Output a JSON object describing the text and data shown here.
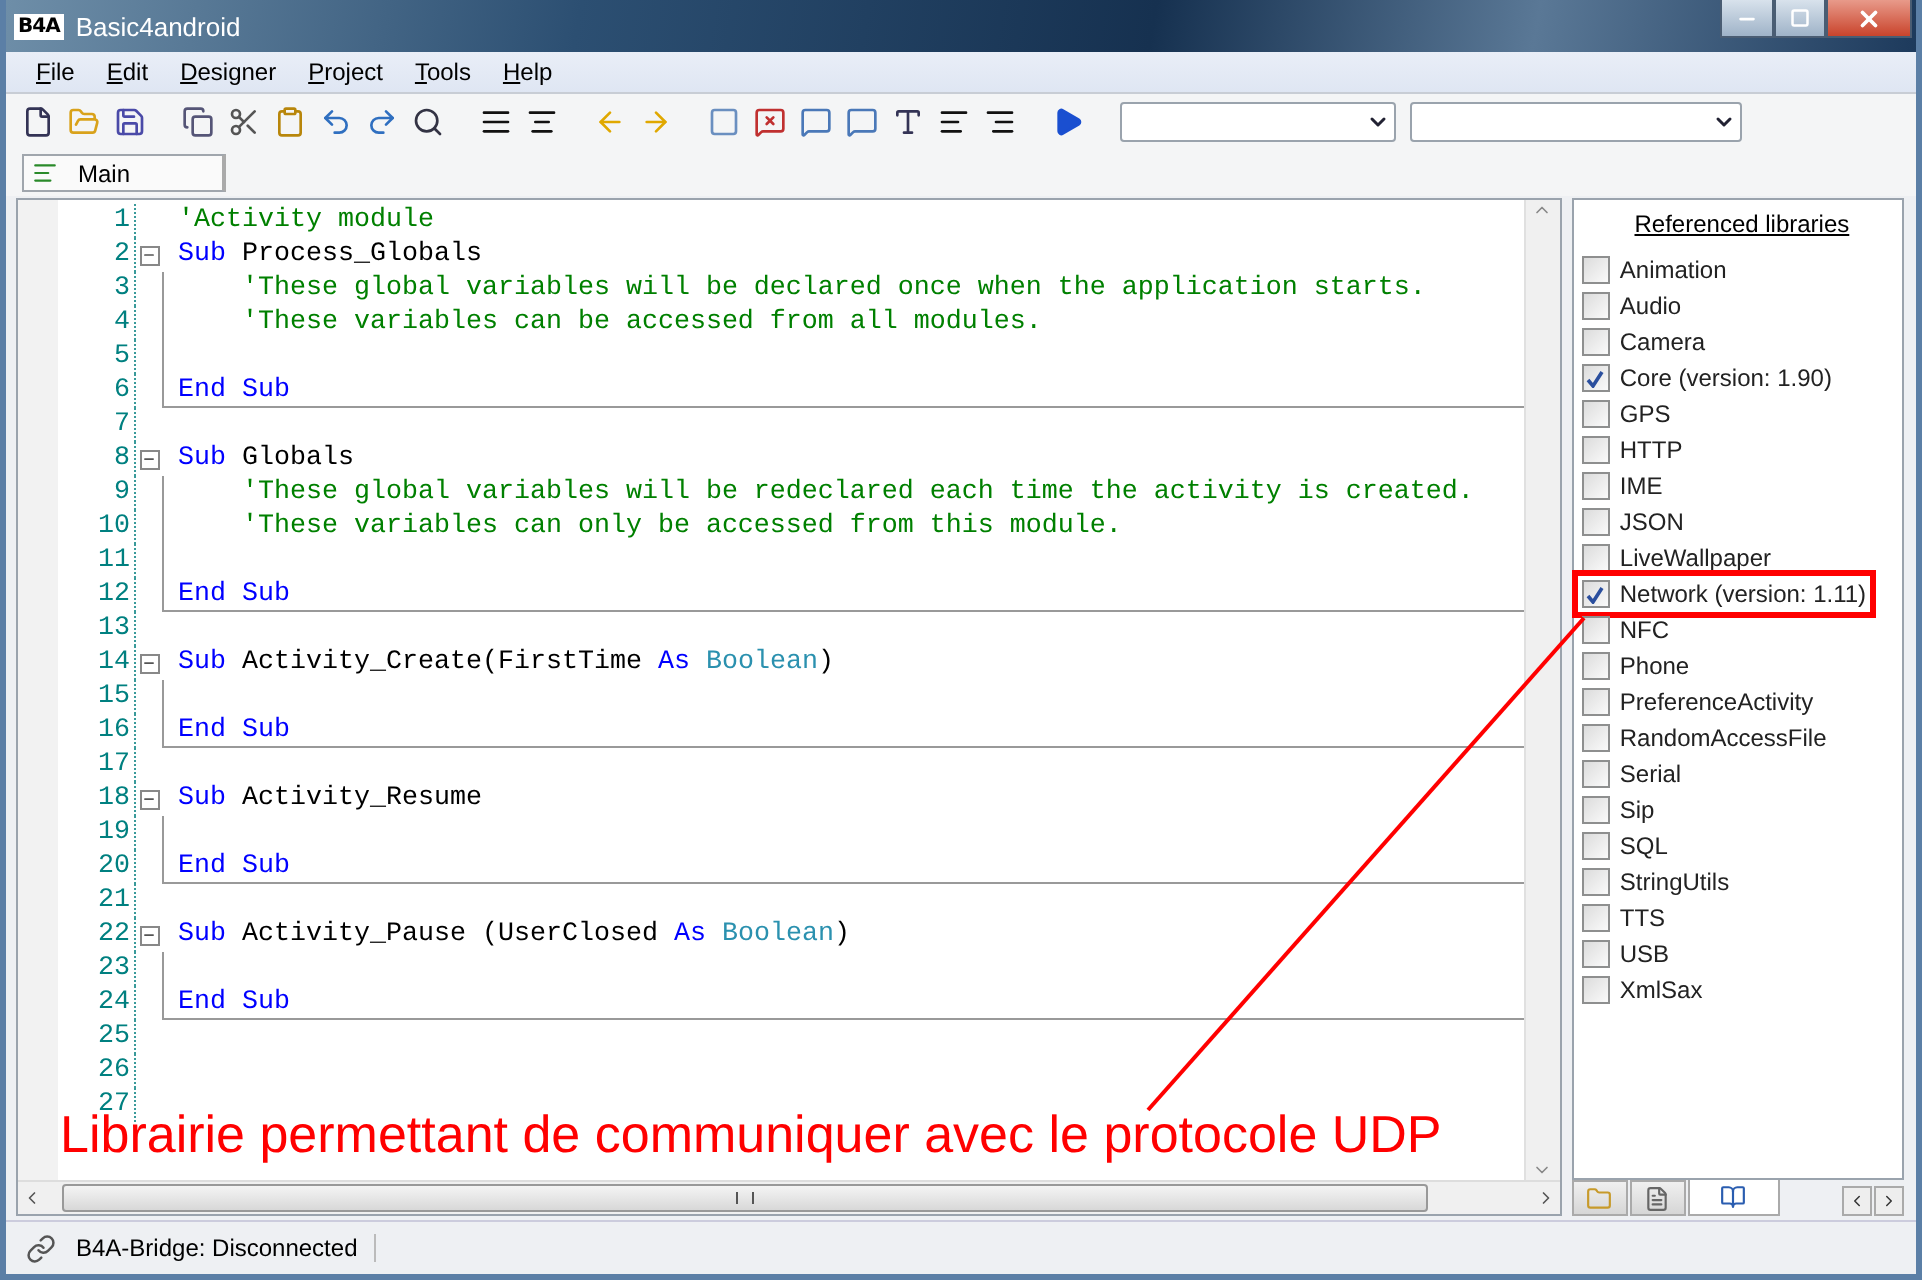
{
  "window": {
    "logo": "B4A",
    "title": "Basic4android"
  },
  "menu": [
    "File",
    "Edit",
    "Designer",
    "Project",
    "Tools",
    "Help"
  ],
  "tabs": [
    {
      "label": "Main",
      "selected": true
    }
  ],
  "editor": {
    "lines": [
      {
        "number": "1",
        "fold": false,
        "block_end": false,
        "tokens": [
          {
            "kind": "comment",
            "text": "'Activity module"
          }
        ]
      },
      {
        "number": "2",
        "fold": true,
        "block_end": false,
        "tokens": [
          {
            "kind": "keyword",
            "text": "Sub"
          },
          {
            "kind": "plain",
            "text": " Process_Globals"
          }
        ]
      },
      {
        "number": "3",
        "fold": false,
        "block_end": false,
        "tokens": [
          {
            "kind": "comment",
            "text": "    'These global variables will be declared once when the application starts."
          }
        ]
      },
      {
        "number": "4",
        "fold": false,
        "block_end": false,
        "tokens": [
          {
            "kind": "comment",
            "text": "    'These variables can be accessed from all modules."
          }
        ]
      },
      {
        "number": "5",
        "fold": false,
        "block_end": false
      },
      {
        "number": "6",
        "fold": false,
        "block_end": true,
        "tokens": [
          {
            "kind": "keyword",
            "text": "End Sub"
          }
        ]
      },
      {
        "number": "7",
        "fold": false,
        "block_end": false
      },
      {
        "number": "8",
        "fold": true,
        "block_end": false,
        "tokens": [
          {
            "kind": "keyword",
            "text": "Sub"
          },
          {
            "kind": "plain",
            "text": " Globals"
          }
        ]
      },
      {
        "number": "9",
        "fold": false,
        "block_end": false,
        "tokens": [
          {
            "kind": "comment",
            "text": "    'These global variables will be redeclared each time the activity is created."
          }
        ]
      },
      {
        "number": "10",
        "fold": false,
        "block_end": false,
        "tokens": [
          {
            "kind": "comment",
            "text": "    'These variables can only be accessed from this module."
          }
        ]
      },
      {
        "number": "11",
        "fold": false,
        "block_end": false
      },
      {
        "number": "12",
        "fold": false,
        "block_end": true,
        "tokens": [
          {
            "kind": "keyword",
            "text": "End Sub"
          }
        ]
      },
      {
        "number": "13",
        "fold": false,
        "block_end": false
      },
      {
        "number": "14",
        "fold": true,
        "block_end": false,
        "tokens": [
          {
            "kind": "keyword",
            "text": "Sub"
          },
          {
            "kind": "plain",
            "text": " Activity_Create(FirstTime "
          },
          {
            "kind": "keyword",
            "text": "As"
          },
          {
            "kind": "type",
            "text": " Boolean"
          },
          {
            "kind": "plain",
            "text": ")"
          }
        ]
      },
      {
        "number": "15",
        "fold": false,
        "block_end": false
      },
      {
        "number": "16",
        "fold": false,
        "block_end": true,
        "tokens": [
          {
            "kind": "keyword",
            "text": "End Sub"
          }
        ]
      },
      {
        "number": "17",
        "fold": false,
        "block_end": false
      },
      {
        "number": "18",
        "fold": true,
        "block_end": false,
        "tokens": [
          {
            "kind": "keyword",
            "text": "Sub"
          },
          {
            "kind": "plain",
            "text": " Activity_Resume"
          }
        ]
      },
      {
        "number": "19",
        "fold": false,
        "block_end": false
      },
      {
        "number": "20",
        "fold": false,
        "block_end": true,
        "tokens": [
          {
            "kind": "keyword",
            "text": "End Sub"
          }
        ]
      },
      {
        "number": "21",
        "fold": false,
        "block_end": false
      },
      {
        "number": "22",
        "fold": true,
        "block_end": false,
        "tokens": [
          {
            "kind": "keyword",
            "text": "Sub"
          },
          {
            "kind": "plain",
            "text": " Activity_Pause (UserClosed "
          },
          {
            "kind": "keyword",
            "text": "As"
          },
          {
            "kind": "type",
            "text": " Boolean"
          },
          {
            "kind": "plain",
            "text": ")"
          }
        ]
      },
      {
        "number": "23",
        "fold": false,
        "block_end": false
      },
      {
        "number": "24",
        "fold": false,
        "block_end": true,
        "tokens": [
          {
            "kind": "keyword",
            "text": "End Sub"
          }
        ]
      },
      {
        "number": "25",
        "fold": false,
        "block_end": false
      },
      {
        "number": "26",
        "fold": false,
        "block_end": false
      },
      {
        "number": "27",
        "fold": false,
        "block_end": false
      }
    ]
  },
  "libraries": {
    "title": "Referenced libraries",
    "items": [
      {
        "name": "Animation",
        "checked": false,
        "highlighted": false
      },
      {
        "name": "Audio",
        "checked": false,
        "highlighted": false
      },
      {
        "name": "Camera",
        "checked": false,
        "highlighted": false
      },
      {
        "name": "Core (version: 1.90)",
        "checked": true,
        "highlighted": false
      },
      {
        "name": "GPS",
        "checked": false,
        "highlighted": false
      },
      {
        "name": "HTTP",
        "checked": false,
        "highlighted": false
      },
      {
        "name": "IME",
        "checked": false,
        "highlighted": false
      },
      {
        "name": "JSON",
        "checked": false,
        "highlighted": false
      },
      {
        "name": "LiveWallpaper",
        "checked": false,
        "highlighted": false
      },
      {
        "name": "Network (version: 1.11)",
        "checked": true,
        "highlighted": true
      },
      {
        "name": "NFC",
        "checked": false,
        "highlighted": false
      },
      {
        "name": "Phone",
        "checked": false,
        "highlighted": false
      },
      {
        "name": "PreferenceActivity",
        "checked": false,
        "highlighted": false
      },
      {
        "name": "RandomAccessFile",
        "checked": false,
        "highlighted": false
      },
      {
        "name": "Serial",
        "checked": false,
        "highlighted": false
      },
      {
        "name": "Sip",
        "checked": false,
        "highlighted": false
      },
      {
        "name": "SQL",
        "checked": false,
        "highlighted": false
      },
      {
        "name": "StringUtils",
        "checked": false,
        "highlighted": false
      },
      {
        "name": "TTS",
        "checked": false,
        "highlighted": false
      },
      {
        "name": "USB",
        "checked": false,
        "highlighted": false
      },
      {
        "name": "XmlSax",
        "checked": false,
        "highlighted": false
      }
    ]
  },
  "panel_tabs": [
    {
      "kind": "files",
      "selected": false
    },
    {
      "kind": "modules",
      "selected": false
    },
    {
      "kind": "libraries",
      "selected": true
    }
  ],
  "annotation": {
    "text": "Librairie permettant de communiquer avec le protocole UDP"
  },
  "status_bar": {
    "text": "B4A-Bridge: Disconnected"
  }
}
